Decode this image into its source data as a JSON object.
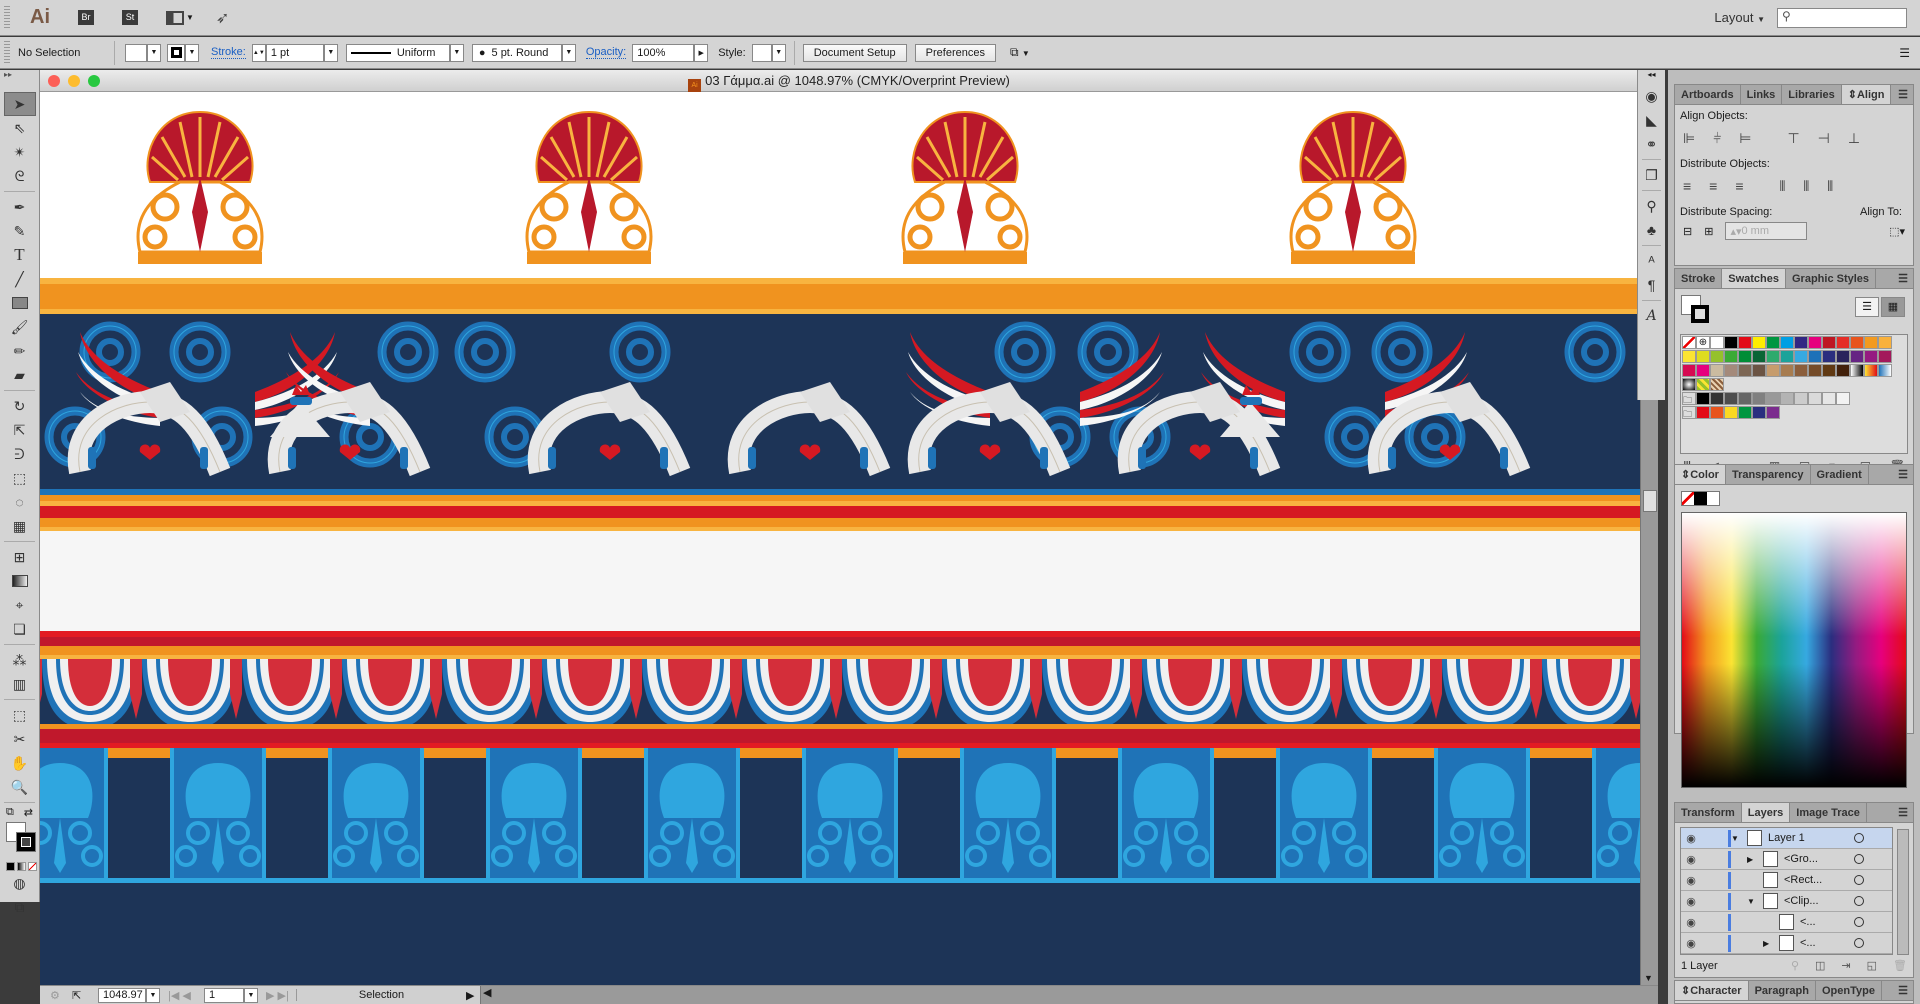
{
  "app": {
    "logo": "Ai",
    "bridge_label": "Br",
    "stock_label": "St",
    "workspace": "Layout",
    "search_placeholder": ""
  },
  "control_bar": {
    "selection_status": "No Selection",
    "stroke_label": "Stroke:",
    "stroke_weight": "1 pt",
    "stroke_profile": "Uniform",
    "brush": "5 pt. Round",
    "opacity_label": "Opacity:",
    "opacity_value": "100%",
    "style_label": "Style:",
    "document_setup": "Document Setup",
    "preferences": "Preferences"
  },
  "document": {
    "title": "03 Γάμμα.ai @ 1048.97% (CMYK/Overprint Preview)",
    "zoom": "1048.97",
    "artboard": "1",
    "status_tool": "Selection",
    "colors": {
      "navy": "#1d3457",
      "orange": "#f0931f",
      "light_orange": "#f8b440",
      "red": "#d51922",
      "dark_red": "#b8182b",
      "blue": "#1f73b7",
      "light_blue": "#2fa6df",
      "off_white": "#f6f6f6"
    }
  },
  "panels": {
    "align": {
      "tabs": [
        "Artboards",
        "Links",
        "Libraries",
        "Align"
      ],
      "active_tab": "Align",
      "align_objects": "Align Objects:",
      "distribute_objects": "Distribute Objects:",
      "distribute_spacing": "Distribute Spacing:",
      "align_to": "Align To:",
      "spacing_value": "0 mm"
    },
    "swatches": {
      "tabs": [
        "Stroke",
        "Swatches",
        "Graphic Styles"
      ],
      "active_tab": "Swatches",
      "rows": [
        [
          "none",
          "registration",
          "#ffffff",
          "#000000",
          "#e30b17",
          "#ffed00",
          "#009640",
          "#009fe3",
          "#312783",
          "#e6007e",
          "#be1622",
          "#e52d27",
          "#e8541d",
          "#f39a1f",
          "#f9b13c"
        ],
        [
          "#fbe433",
          "#dedc1f",
          "#95c12b",
          "#3aaa35",
          "#008d36",
          "#0a6535",
          "#2daa6d",
          "#1ba39a",
          "#36a9e1",
          "#1d71b8",
          "#2a2e7f",
          "#29235c",
          "#662483",
          "#951b81",
          "#a3195b"
        ],
        [
          "#d60b52",
          "#e6007e",
          "#cbbba0",
          "#a48a7b",
          "#7d6755",
          "#6b5444",
          "#c69c6d",
          "#a77c50",
          "#8b5e3c",
          "#754c29",
          "#603913",
          "#42210b",
          "gradient-bw",
          "gradient-orange",
          "gradient-blue"
        ],
        [
          "pattern-dots",
          "pattern-leaf",
          "pattern-brown"
        ]
      ],
      "gray_group": [
        "#000000",
        "#333333",
        "#4d4d4d",
        "#666666",
        "#808080",
        "#999999",
        "#b3b3b3",
        "#cccccc",
        "#dadada",
        "#e6e6e6",
        "#f2f2f2"
      ],
      "color_group": [
        "#e30b17",
        "#e8541d",
        "#fbd922",
        "#009640",
        "#2a2e7f",
        "#7b2d8e"
      ]
    },
    "color": {
      "tabs": [
        "Color",
        "Transparency",
        "Gradient"
      ],
      "active_tab": "Color"
    },
    "layers": {
      "tabs": [
        "Transform",
        "Layers",
        "Image Trace"
      ],
      "active_tab": "Layers",
      "rows": [
        {
          "name": "Layer 1",
          "indent": 0,
          "expanded": true,
          "selected": true
        },
        {
          "name": "<Gro...",
          "indent": 1,
          "expanded": false
        },
        {
          "name": "<Rect...",
          "indent": 1,
          "expanded": null
        },
        {
          "name": "<Clip...",
          "indent": 1,
          "expanded": true
        },
        {
          "name": "<...",
          "indent": 2,
          "expanded": null
        },
        {
          "name": "<...",
          "indent": 2,
          "expanded": false
        }
      ],
      "footer": "1 Layer"
    },
    "character": {
      "tabs": [
        "Character",
        "Paragraph",
        "OpenType"
      ],
      "active_tab": "Character"
    }
  }
}
